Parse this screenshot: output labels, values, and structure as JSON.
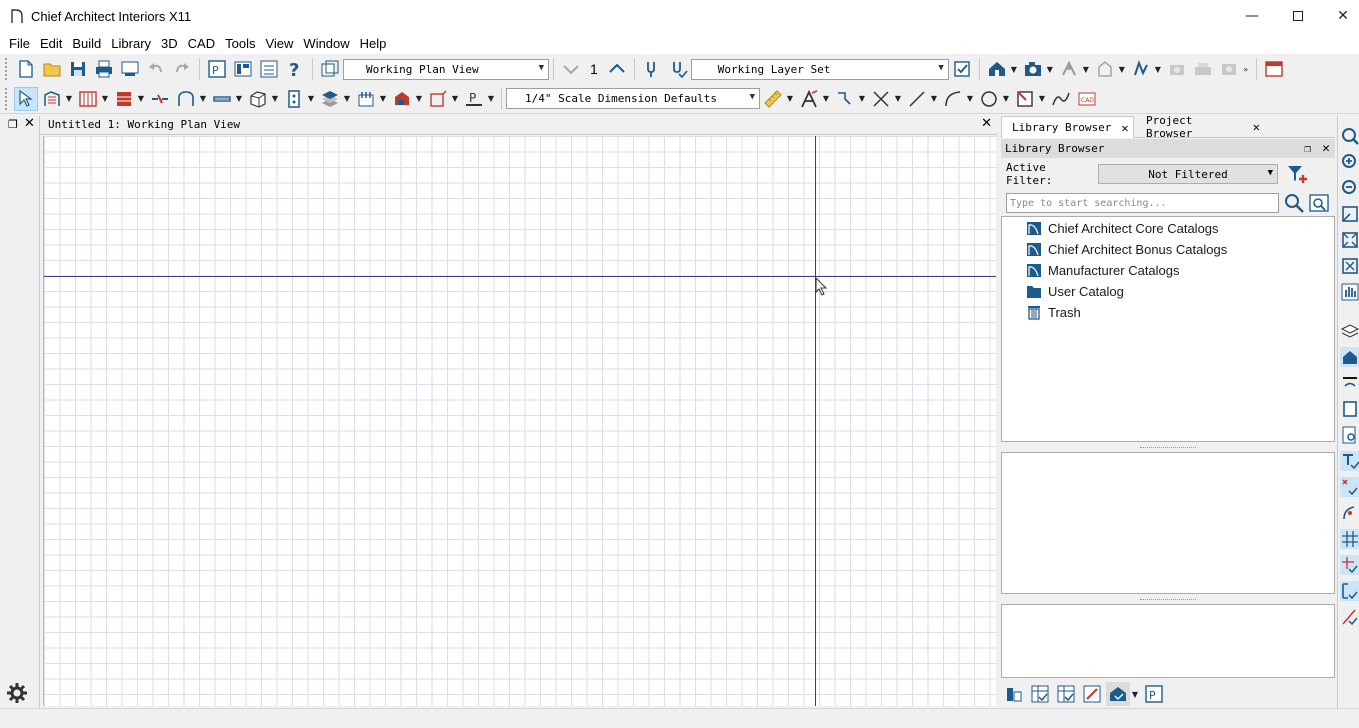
{
  "window": {
    "title": "Chief Architect Interiors X11",
    "controls": [
      "minimize",
      "maximize",
      "close"
    ]
  },
  "menu": [
    {
      "label": "File",
      "key": "F"
    },
    {
      "label": "Edit",
      "key": "E"
    },
    {
      "label": "Build",
      "key": "B"
    },
    {
      "label": "Library",
      "key": "L"
    },
    {
      "label": "3D",
      "key": "3"
    },
    {
      "label": "CAD",
      "key": "C"
    },
    {
      "label": "Tools",
      "key": "T"
    },
    {
      "label": "View",
      "key": "V"
    },
    {
      "label": "Window",
      "key": "W"
    },
    {
      "label": "Help",
      "key": "H"
    }
  ],
  "toolbar": {
    "plan_view": "Working Plan View",
    "floor_number": "1",
    "layer_set": "Working Layer Set",
    "dimension_defaults": "1/4\" Scale Dimension Defaults"
  },
  "document": {
    "tab_label": "Untitled 1:  Working Plan View"
  },
  "library": {
    "tabs": [
      "Library Browser",
      "Project Browser"
    ],
    "active_tab": "Library Browser",
    "panel_title": "Library Browser",
    "filter_label": "Active Filter:",
    "filter_value": "Not Filtered",
    "search_placeholder": "Type to start searching...",
    "items": [
      {
        "label": "Chief Architect Core Catalogs",
        "icon": "catalog-icon"
      },
      {
        "label": "Chief Architect Bonus Catalogs",
        "icon": "catalog-icon"
      },
      {
        "label": "Manufacturer Catalogs",
        "icon": "catalog-icon"
      },
      {
        "label": "User Catalog",
        "icon": "folder-icon"
      },
      {
        "label": "Trash",
        "icon": "trash-icon"
      }
    ]
  },
  "colors": {
    "accent": "#1f5a8c",
    "grid": "#dedaf0",
    "axis": "#3c3c8a"
  }
}
